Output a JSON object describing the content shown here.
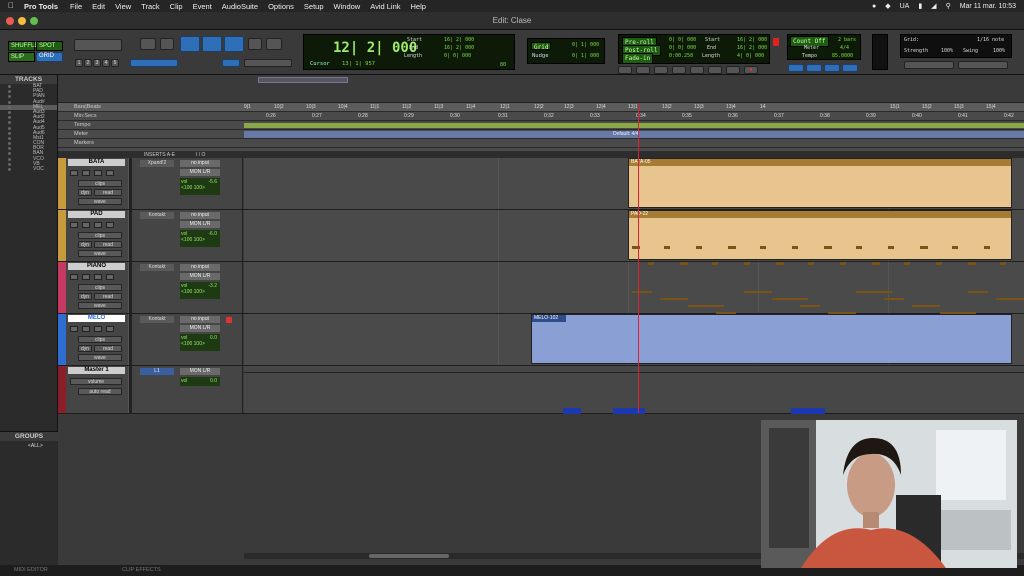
{
  "menubar": {
    "app_name": "Pro Tools",
    "items": [
      "File",
      "Edit",
      "View",
      "Track",
      "Clip",
      "Event",
      "AudioSuite",
      "Options",
      "Setup",
      "Window",
      "Avid Link",
      "Help"
    ],
    "lang": "UA",
    "clock": "Mar 11 mar.  10:53"
  },
  "window": {
    "title": "Edit: Clase"
  },
  "toolbar": {
    "counter_main": "12| 2| 000",
    "cursor_label": "Cursor",
    "cursor_value": "13| 1| 957",
    "start_label": "Start",
    "start_value": "16| 2| 000",
    "end_label": "End",
    "end_value": "16| 2| 000",
    "length_label": "Length",
    "length_value": "0| 0| 000",
    "grid_label": "Grid",
    "grid_value": "0| 1| 000",
    "nudge_label": "Nudge",
    "nudge_value": "0| 1| 000",
    "qty_value": "80",
    "preroll_label": "Pre-roll",
    "preroll_value": "0| 0| 000",
    "postroll_label": "Post-roll",
    "postroll_value": "0| 0| 000",
    "fadein_label": "Fade-in",
    "fadein_value": "0:00.250",
    "start2_label": "Start",
    "start2_value": "16| 2| 000",
    "end2_label": "End",
    "end2_value": "16| 2| 000",
    "length2_label": "Length",
    "length2_value": "4| 0| 000",
    "count_off": "Count Off",
    "count_off_value": "2 bars",
    "meter_label": "Meter",
    "meter_value": "4/4",
    "tempo_label": "Tempo",
    "tempo_value": "85.0000",
    "mode_shuffle": "SHUFFLE",
    "mode_spot": "SPOT",
    "mode_slip": "SLIP",
    "mode_grid": "GRID",
    "quant_grid_label": "Grid:",
    "quant_grid_value": "1/16 note",
    "strength_label": "Strength",
    "strength_value": "100%",
    "swing_label": "Swing",
    "swing_value": "100%",
    "numbers": [
      "1",
      "2",
      "3",
      "4",
      "5"
    ]
  },
  "tracks_panel": {
    "title": "TRACKS",
    "items": [
      "BAT",
      "PAD",
      "PIAN",
      "Aud#",
      "MEL",
      "Aud3",
      "Aud2",
      "Aud4",
      "Aud5",
      "Aud6",
      "Mst1",
      "CON",
      "BOR",
      "BAN",
      "VCO",
      "VB",
      "VOC"
    ]
  },
  "groups_panel": {
    "title": "GROUPS",
    "items": [
      "<ALL>"
    ]
  },
  "rulers": {
    "bars_beats_label": "Bars|Beats",
    "min_secs_label": "Min:Secs",
    "tempo_label": "Tempo",
    "meter_label": "Meter",
    "markers_label": "Markers",
    "meter_default": "Default: 4/4",
    "bars": [
      "9|1",
      "10|2",
      "10|3",
      "10|4",
      "11|1",
      "11|2",
      "11|3",
      "11|4",
      "12|1",
      "12|2",
      "12|3",
      "12|4",
      "13|1",
      "13|2",
      "13|3",
      "13|4",
      "14",
      "15|1",
      "15|2",
      "15|3",
      "15|4"
    ],
    "secs": [
      "0:26",
      "0:27",
      "0:28",
      "0:29",
      "0:30",
      "0:31",
      "0:32",
      "0:33",
      "0:34",
      "0:35",
      "0:36",
      "0:37",
      "0:38",
      "0:39",
      "0:40",
      "0:41",
      "0:42"
    ]
  },
  "mix_header": {
    "inserts": "INSERTS A-E",
    "io": "I / O"
  },
  "tracks": [
    {
      "name": "BATA",
      "insert": "Xpand!2",
      "input": "no input",
      "output": "MON L/R",
      "vol": "vol",
      "vol_value": "-5.6",
      "pan": "<100  100>",
      "clips": "clips",
      "dyn": "dyn",
      "read": "read",
      "wave": "wave",
      "color": "#c79a3c",
      "clip_name": "BATA-05"
    },
    {
      "name": "PAD",
      "insert": "Kontakt",
      "input": "no input",
      "output": "MON L/R",
      "vol": "vol",
      "vol_value": "-6.0",
      "pan": "<100  100>",
      "clips": "clips",
      "dyn": "dyn",
      "read": "read",
      "wave": "wave",
      "color": "#c79a3c",
      "clip_name": "PAD-22"
    },
    {
      "name": "PIANO",
      "insert": "Kontakt",
      "input": "no input",
      "output": "MON L/R",
      "vol": "vol",
      "vol_value": "-3.2",
      "pan": "<100  100>",
      "clips": "clips",
      "dyn": "dyn",
      "read": "read",
      "wave": "wave",
      "color": "#c43a63",
      "clip_name": ""
    },
    {
      "name": "MELO",
      "insert": "Kontakt",
      "input": "no input",
      "output": "MON L/R",
      "vol": "vol",
      "vol_value": "0.0",
      "pan": "<100  100>",
      "clips": "clips",
      "dyn": "dyn",
      "read": "read",
      "wave": "wave",
      "color": "#2f6ed0",
      "clip_name": "MELO-102"
    },
    {
      "name": "Master 1",
      "insert": "",
      "input": "L1",
      "output": "MON L/R",
      "vol": "vol",
      "vol_value": "0.0",
      "pan": "",
      "clips": "volume",
      "dyn": "",
      "read": "auto read",
      "wave": "",
      "color": "#8a1f2a",
      "clip_name": ""
    }
  ],
  "bottom_tabs": [
    "MIDI EDITOR",
    "CLIP EFFECTS"
  ],
  "colors": {
    "accent_blue": "#2f6fb8",
    "lcd_green": "#7fdc4a",
    "clip_tan": "#e8c48e",
    "clip_blue": "#8a9fd4"
  }
}
